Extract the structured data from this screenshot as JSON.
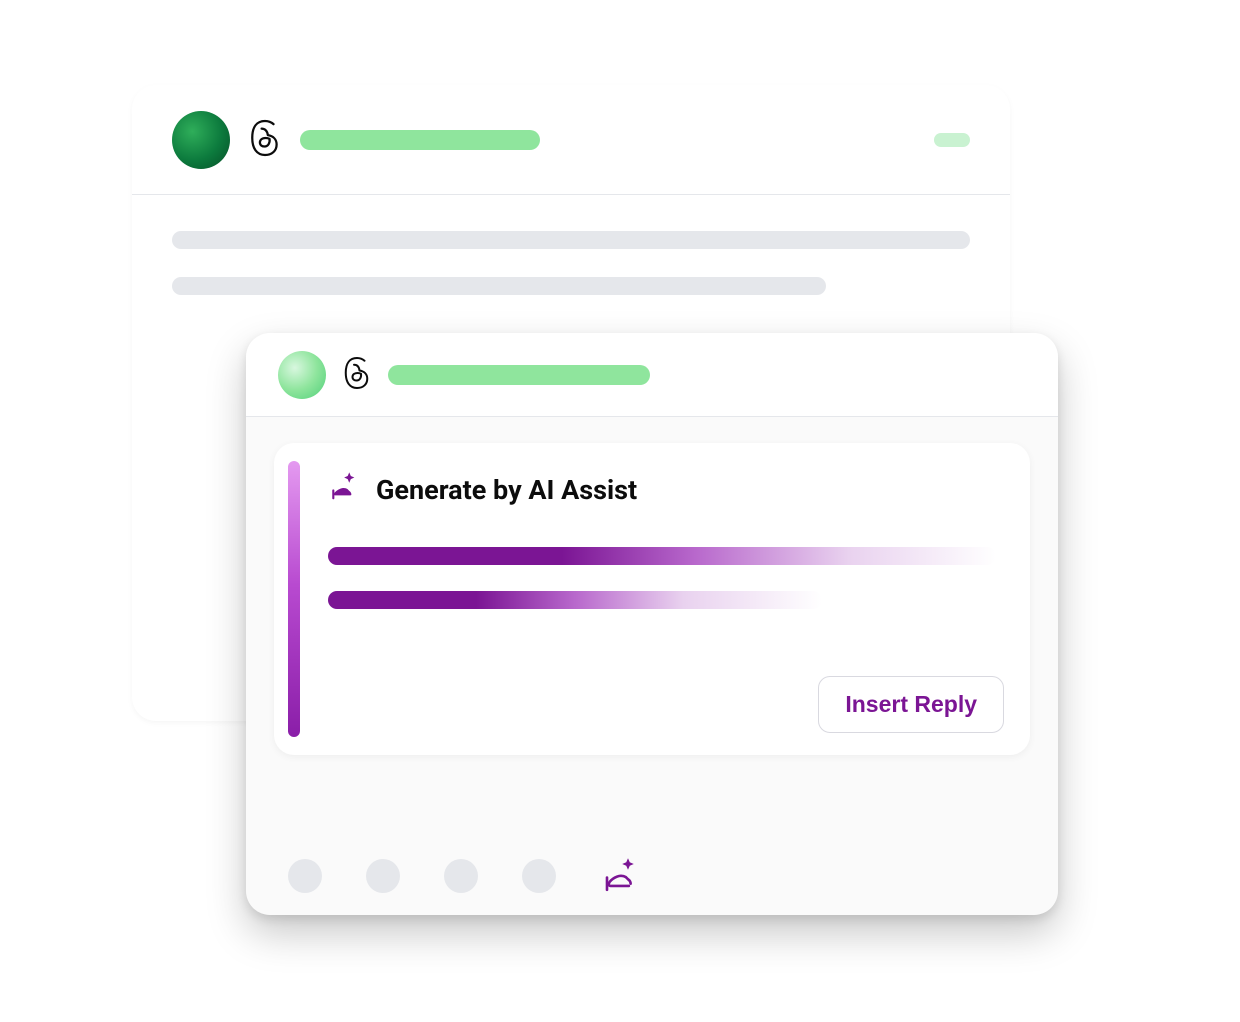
{
  "back_card": {
    "avatar": "user-avatar",
    "platform_icon": "threads-icon"
  },
  "front_card": {
    "avatar": "user-avatar",
    "platform_icon": "threads-icon",
    "toolbar_slots": 4
  },
  "ai_panel": {
    "title": "Generate by AI Assist",
    "insert_button": "Insert Reply"
  },
  "colors": {
    "accent_green": "#8fe59d",
    "accent_purple": "#7b1594",
    "placeholder_grey": "#e5e7eb"
  }
}
